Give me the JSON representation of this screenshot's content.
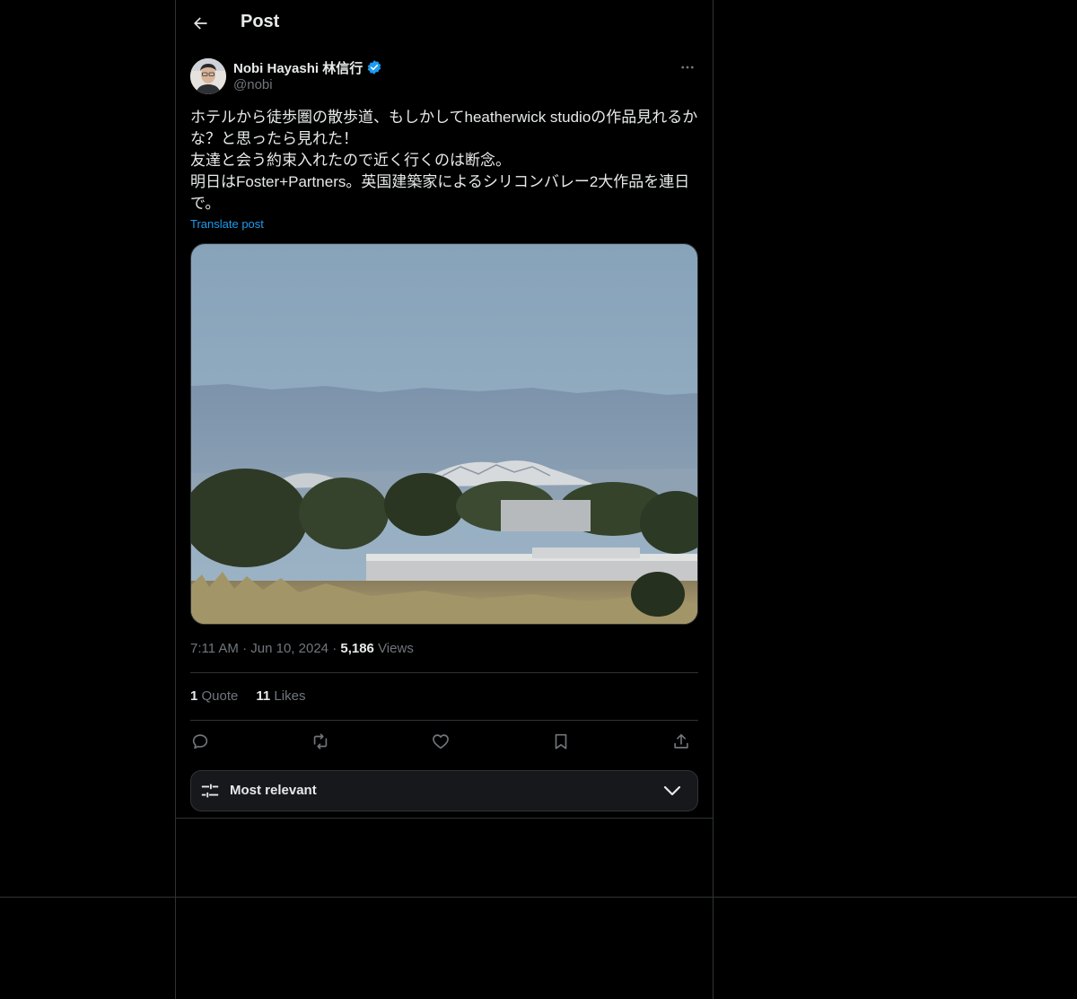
{
  "header": {
    "title": "Post"
  },
  "author": {
    "display_name": "Nobi Hayashi 林信行",
    "handle": "@nobi"
  },
  "post": {
    "lines": [
      "ホテルから徒歩圏の散歩道、もしかしてheatherwick studioの作品見れるかな？と思ったら見れた！",
      "友達と会う約束入れたので近く行くのは断念。",
      "明日はFoster+Partners。英国建築家によるシリコンバレー2大作品を連日で。"
    ],
    "translate_label": "Translate post"
  },
  "meta": {
    "time": "7:11 AM",
    "sep": "·",
    "date": "Jun 10, 2024",
    "views_count": "5,186",
    "views_label": "Views"
  },
  "stats": {
    "quote_count": "1",
    "quote_label": "Quote",
    "likes_count": "11",
    "likes_label": "Likes"
  },
  "sort": {
    "label": "Most relevant"
  },
  "colors": {
    "background": "#000000",
    "accent": "#1d9bf0",
    "border": "#2f3336",
    "muted": "#71767b",
    "text": "#e7e9ea"
  },
  "icons": [
    "back-arrow-icon",
    "verified-badge-icon",
    "more-icon",
    "reply-icon",
    "repost-icon",
    "like-icon",
    "bookmark-icon",
    "share-icon",
    "sliders-icon",
    "chevron-down-icon"
  ]
}
